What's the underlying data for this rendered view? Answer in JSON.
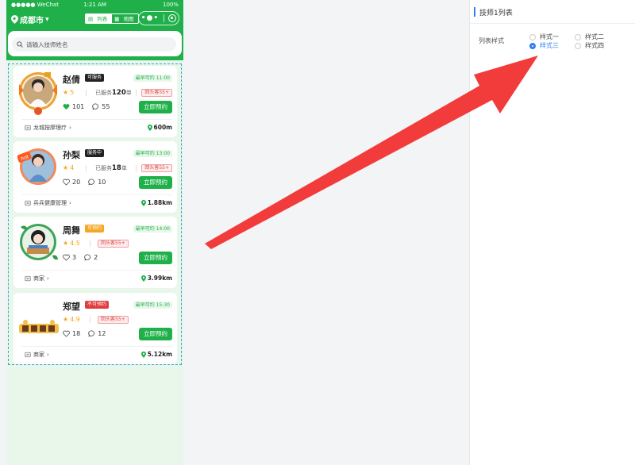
{
  "status": {
    "carrier": "●●●●● WeChat",
    "time": "1:21 AM",
    "battery": "100%"
  },
  "nav": {
    "city": "成都市",
    "tabs": [
      {
        "label": "列表",
        "active": true
      },
      {
        "label": "地图",
        "active": false
      }
    ]
  },
  "search": {
    "placeholder": "请输入技师姓名"
  },
  "cards": [
    {
      "name": "赵倩",
      "status": "可服务",
      "status_color": "#222222",
      "earliest": "最早可约 11:00",
      "rating": "5",
      "served_label": "已服务",
      "served_count": "120",
      "served_unit": "单",
      "age_tag": "回头客55+",
      "likes": "101",
      "comments": "55",
      "book": "立即预约",
      "shop": "龙城按摩理疗",
      "distance": "600m",
      "liked": true
    },
    {
      "name": "孙梨",
      "status": "服务中",
      "status_color": "#222222",
      "earliest": "最早可约 13:00",
      "rating": "4",
      "served_label": "已服务",
      "served_count": "18",
      "served_unit": "单",
      "age_tag": "回头客55+",
      "likes": "20",
      "comments": "10",
      "book": "立即预约",
      "shop": "兵兵健康管理",
      "distance": "1.88km",
      "liked": false
    },
    {
      "name": "周舞",
      "status": "可预约",
      "status_color": "#f5a623",
      "earliest": "最早可约 14:00",
      "rating": "4.5",
      "served_label": "",
      "served_count": "",
      "served_unit": "",
      "age_tag": "回头客55+",
      "likes": "3",
      "comments": "2",
      "book": "立即预约",
      "shop": "商家",
      "distance": "3.99km",
      "liked": false
    },
    {
      "name": "郑望",
      "status": "不可预约",
      "status_color": "#e03c3c",
      "earliest": "最早可约 15:30",
      "rating": "4.9",
      "served_label": "",
      "served_count": "",
      "served_unit": "",
      "age_tag": "回头客55+",
      "likes": "18",
      "comments": "12",
      "book": "立即预约",
      "shop": "商家",
      "distance": "5.12km",
      "liked": false
    }
  ],
  "panel": {
    "title": "技师1列表",
    "label": "列表样式",
    "options": [
      {
        "label": "样式一",
        "checked": false
      },
      {
        "label": "样式二",
        "checked": false
      },
      {
        "label": "样式三",
        "checked": true
      },
      {
        "label": "样式四",
        "checked": false
      }
    ]
  },
  "colors": {
    "brand": "#20b04a",
    "accent": "#2f7ff0",
    "arrow": "#f23b3b"
  }
}
